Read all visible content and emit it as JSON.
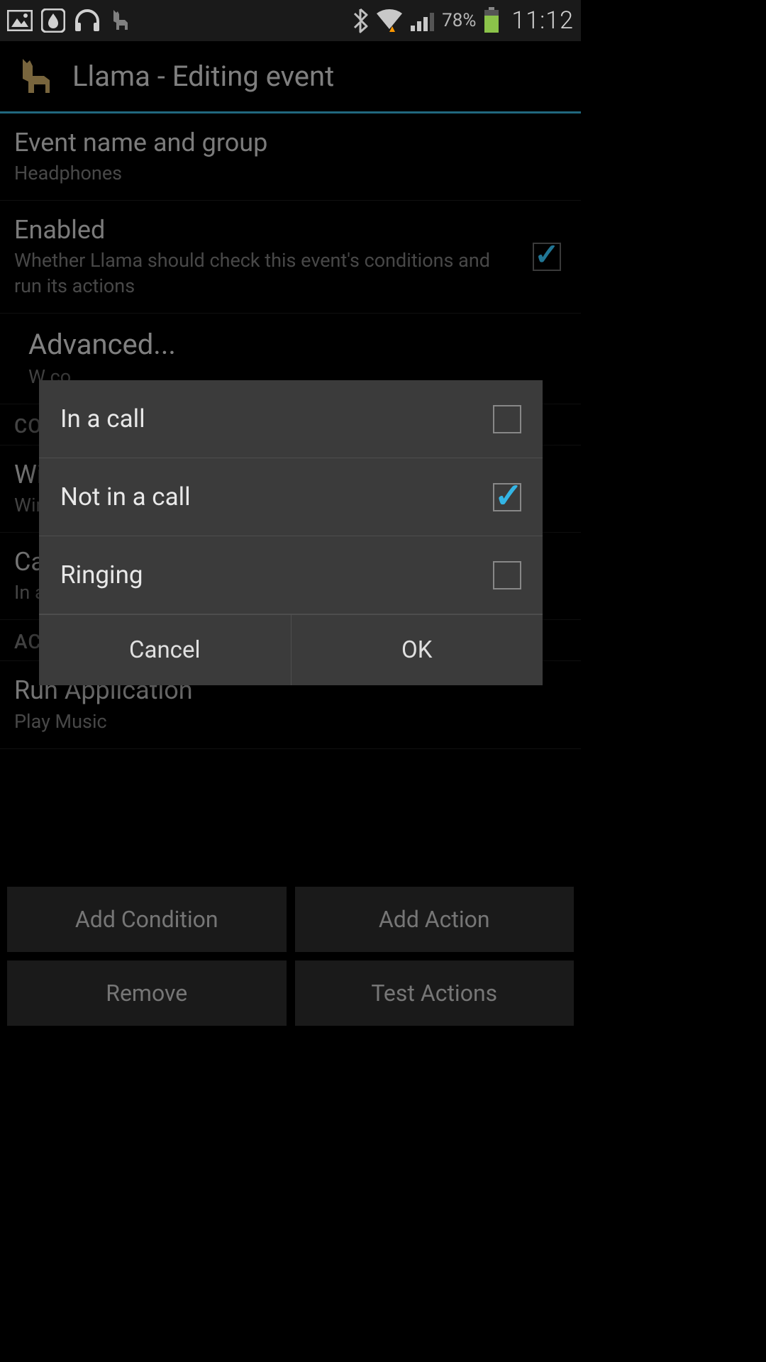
{
  "status": {
    "battery_percent": "78%",
    "time": "11:12"
  },
  "header": {
    "title": "Llama - Editing event"
  },
  "items": {
    "event_name": {
      "title": "Event name and group",
      "value": "Headphones"
    },
    "enabled": {
      "title": "Enabled",
      "sub": "Whether Llama should check this event's conditions and run its actions",
      "checked": true
    },
    "advanced": {
      "title": "Advanced...",
      "sub": "W\nco"
    },
    "wifi": {
      "title": "Wi",
      "sub": "Wir"
    },
    "call": {
      "title": "Ca",
      "sub": "In a"
    },
    "run_app": {
      "title": "Run Application",
      "sub": "Play Music"
    }
  },
  "sections": {
    "conditions": "CO",
    "actions": "ACTIONS"
  },
  "buttons": {
    "add_condition": "Add Condition",
    "add_action": "Add Action",
    "remove": "Remove",
    "test_actions": "Test Actions"
  },
  "dialog": {
    "options": [
      {
        "label": "In a call",
        "checked": false
      },
      {
        "label": "Not in a call",
        "checked": true
      },
      {
        "label": "Ringing",
        "checked": false
      }
    ],
    "cancel": "Cancel",
    "ok": "OK"
  },
  "colors": {
    "accent": "#33b5e5",
    "header_underline": "#33a0c4",
    "battery_fill": "#8bc34a"
  }
}
